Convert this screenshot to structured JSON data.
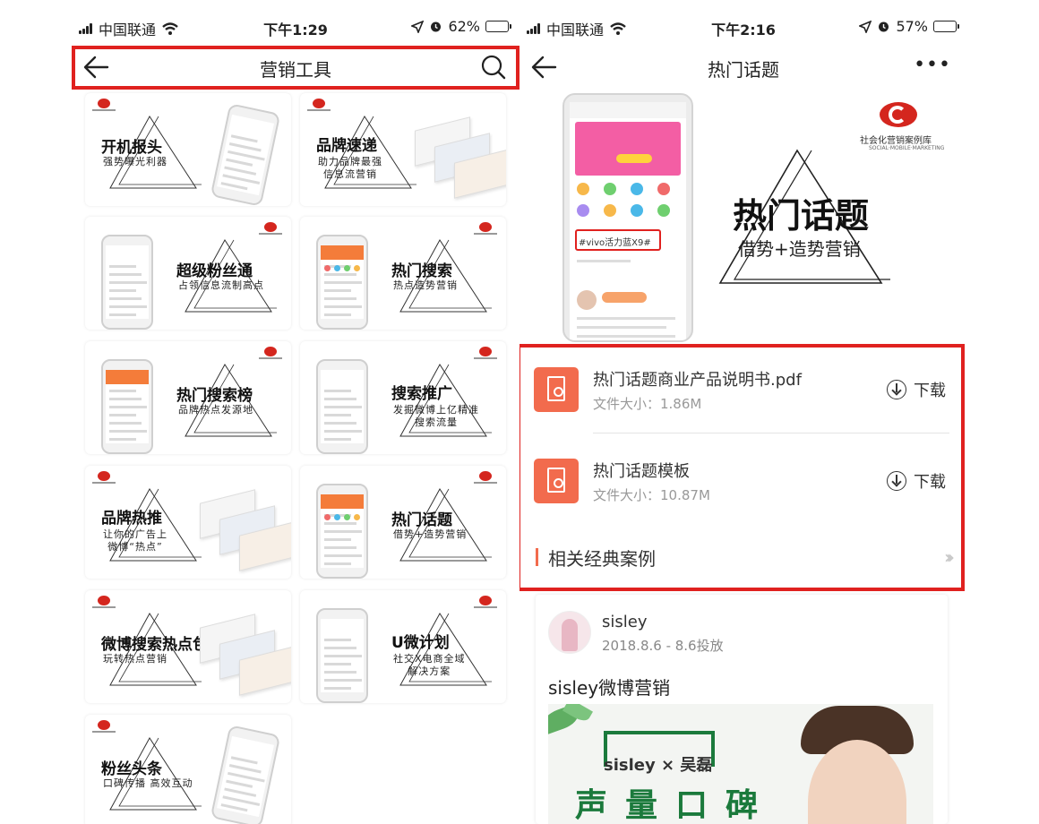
{
  "left": {
    "status": {
      "carrier": "中国联通",
      "time": "下午1:29",
      "battery": "62%",
      "battery_level": 0.62
    },
    "nav": {
      "title": "营销工具"
    },
    "tiles": [
      {
        "title": "开机报头",
        "subtitle": "强势曝光利器"
      },
      {
        "title": "品牌速递",
        "subtitle": "助力品牌最强\n信息流营销"
      },
      {
        "title": "超级粉丝通",
        "subtitle": "占领信息流制高点"
      },
      {
        "title": "热门搜索",
        "subtitle": "热点造势营销"
      },
      {
        "title": "热门搜索榜",
        "subtitle": "品牌热点发源地"
      },
      {
        "title": "搜索推广",
        "subtitle": "发掘微博上亿精准\n搜索流量"
      },
      {
        "title": "品牌热推",
        "subtitle": "让你的广告上\n微博“热点”"
      },
      {
        "title": "热门话题",
        "subtitle": "借势+造势营销"
      },
      {
        "title": "微博搜索热点包",
        "subtitle": "玩转热点营销"
      },
      {
        "title": "U微计划",
        "subtitle": "社交X电商全域\n解决方案"
      },
      {
        "title": "粉丝头条",
        "subtitle": "口碑传播 高效互动"
      }
    ]
  },
  "right": {
    "status": {
      "carrier": "中国联通",
      "time": "下午2:16",
      "battery": "57%",
      "battery_level": 0.57
    },
    "nav": {
      "title": "热门话题",
      "more": "•••"
    },
    "banner": {
      "title": "热门话题",
      "subtitle": "借势+造势营销",
      "logo_text": "社会化营销案例库",
      "logo_sub": "SOCIAL·MOBILE·MARKETING",
      "phone_tag": "#vivo活力蓝X9#"
    },
    "files": [
      {
        "name": "热门话题商业产品说明书.pdf",
        "size": "文件大小：1.86M",
        "action": "下载"
      },
      {
        "name": "热门话题模板",
        "size": "文件大小：10.87M",
        "action": "下载"
      }
    ],
    "related": {
      "label": "相关经典案例",
      "chevron": "›››"
    },
    "case": {
      "user": "sisley",
      "date": "2018.8.6 - 8.6投放",
      "title": "sisley微博营销",
      "image_brand": "sisley × 吴磊",
      "image_text": "声量口碑"
    }
  },
  "colors": {
    "highlight": "#e0211f",
    "accent": "#f26b4d",
    "logo_red": "#d4261e"
  }
}
